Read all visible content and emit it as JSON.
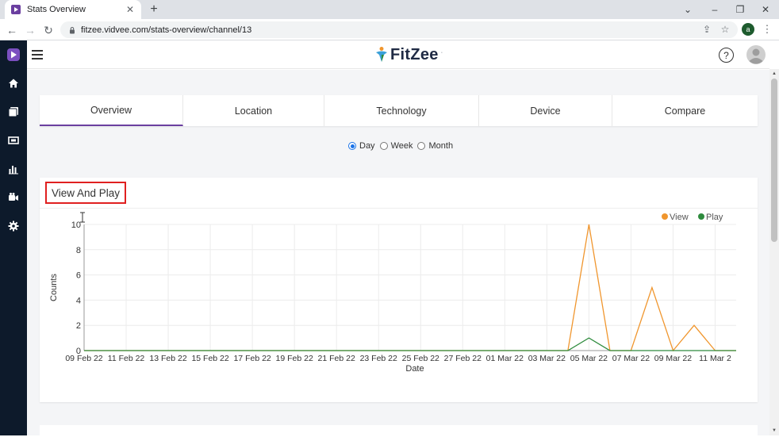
{
  "browser": {
    "tab_title": "Stats Overview",
    "url": "fitzee.vidvee.com/stats-overview/channel/13",
    "profile_initial": "a"
  },
  "app": {
    "logo_text": "FitZee",
    "logo_mark": "·"
  },
  "tabs": [
    {
      "label": "Overview",
      "active": true
    },
    {
      "label": "Location",
      "active": false
    },
    {
      "label": "Technology",
      "active": false
    },
    {
      "label": "Device",
      "active": false
    },
    {
      "label": "Compare",
      "active": false
    }
  ],
  "period": {
    "options": [
      {
        "label": "Day",
        "checked": true
      },
      {
        "label": "Week",
        "checked": false
      },
      {
        "label": "Month",
        "checked": false
      }
    ]
  },
  "card": {
    "title": "View And Play"
  },
  "colors": {
    "view": "#f0962e",
    "play": "#2e8b3d",
    "active_tab": "#6b3fa0",
    "sidebar": "#0d1a2b"
  },
  "chart_data": {
    "type": "line",
    "xlabel": "Date",
    "ylabel": "Counts",
    "ylim": [
      0,
      10
    ],
    "yticks": [
      0,
      2,
      4,
      6,
      8,
      10
    ],
    "legend_position": "top-right",
    "x_tick_labels": [
      "09 Feb 22",
      "11 Feb 22",
      "13 Feb 22",
      "15 Feb 22",
      "17 Feb 22",
      "19 Feb 22",
      "21 Feb 22",
      "23 Feb 22",
      "25 Feb 22",
      "27 Feb 22",
      "01 Mar 22",
      "03 Mar 22",
      "05 Mar 22",
      "07 Mar 22",
      "09 Mar 22",
      "11 Mar 2"
    ],
    "x": [
      "09 Feb 22",
      "10 Feb 22",
      "11 Feb 22",
      "12 Feb 22",
      "13 Feb 22",
      "14 Feb 22",
      "15 Feb 22",
      "16 Feb 22",
      "17 Feb 22",
      "18 Feb 22",
      "19 Feb 22",
      "20 Feb 22",
      "21 Feb 22",
      "22 Feb 22",
      "23 Feb 22",
      "24 Feb 22",
      "25 Feb 22",
      "26 Feb 22",
      "27 Feb 22",
      "28 Feb 22",
      "01 Mar 22",
      "02 Mar 22",
      "03 Mar 22",
      "04 Mar 22",
      "05 Mar 22",
      "06 Mar 22",
      "07 Mar 22",
      "08 Mar 22",
      "09 Mar 22",
      "10 Mar 22",
      "11 Mar 22",
      "12 Mar 22"
    ],
    "series": [
      {
        "name": "View",
        "values": [
          0,
          0,
          0,
          0,
          0,
          0,
          0,
          0,
          0,
          0,
          0,
          0,
          0,
          0,
          0,
          0,
          0,
          0,
          0,
          0,
          0,
          0,
          0,
          0,
          10,
          0,
          0,
          5,
          0,
          2,
          0,
          0
        ]
      },
      {
        "name": "Play",
        "values": [
          0,
          0,
          0,
          0,
          0,
          0,
          0,
          0,
          0,
          0,
          0,
          0,
          0,
          0,
          0,
          0,
          0,
          0,
          0,
          0,
          0,
          0,
          0,
          0,
          1,
          0,
          0,
          0,
          0,
          0,
          0,
          0
        ]
      }
    ]
  }
}
